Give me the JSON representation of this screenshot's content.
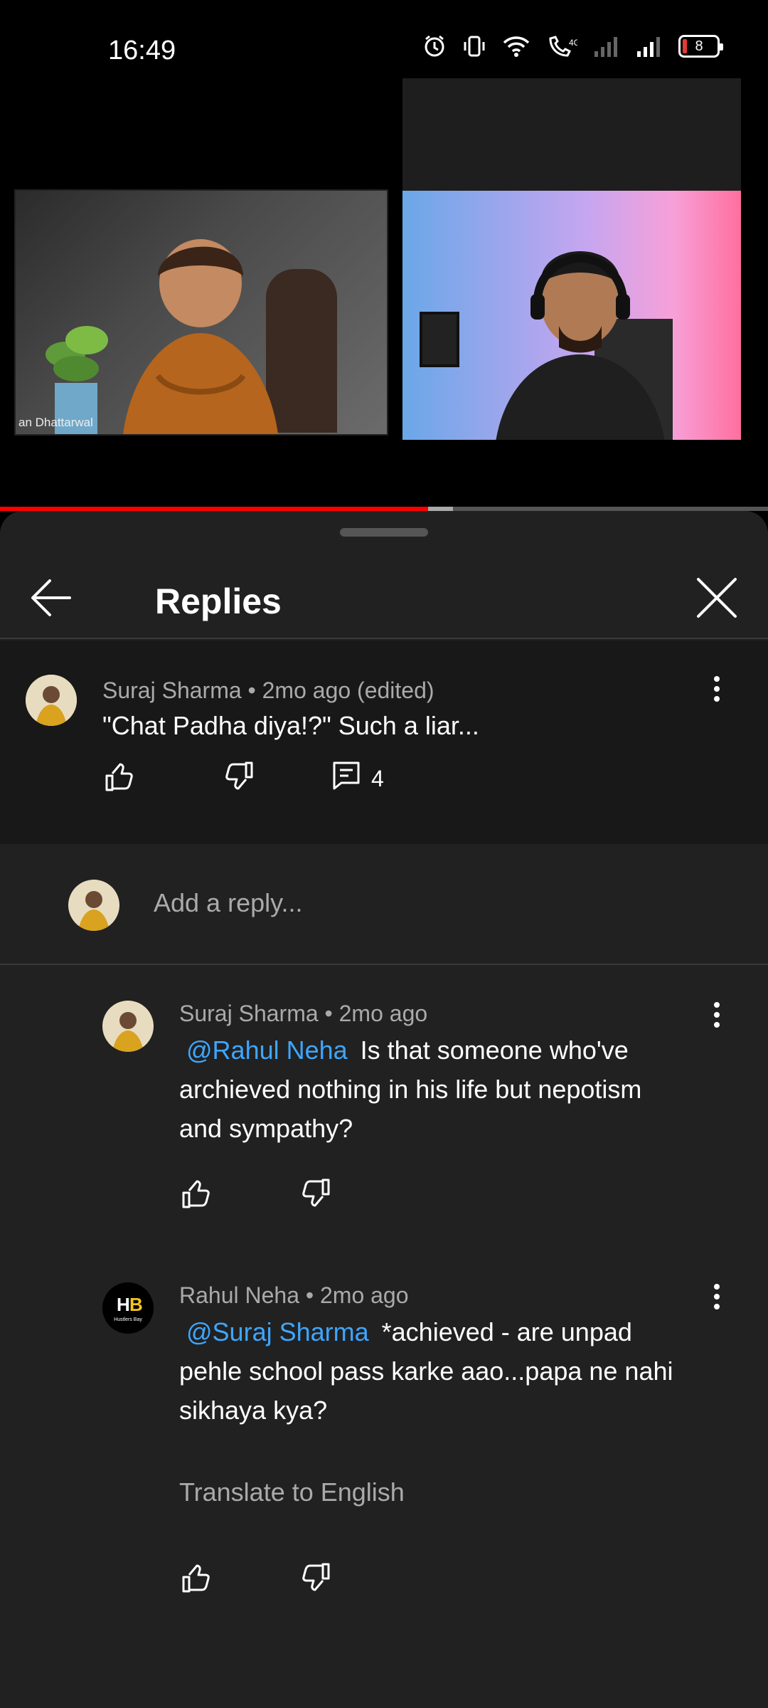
{
  "status_bar": {
    "time": "16:49",
    "battery": "8",
    "icons": [
      "alarm-icon",
      "vibrate-icon",
      "wifi-icon",
      "volte-call-icon",
      "signal-sim1-icon",
      "signal-sim2-icon",
      "battery-icon"
    ]
  },
  "video": {
    "left_participant_label": "an Dhattarwal",
    "progress": 0.557,
    "buffered": 0.59
  },
  "sheet": {
    "title": "Replies"
  },
  "parent_comment": {
    "author": "Suraj Sharma",
    "meta": "Suraj Sharma • 2mo ago (edited)",
    "text": "\"Chat Padha diya!?\" Such a liar...",
    "reply_count": "4"
  },
  "add_reply": {
    "placeholder": "Add a reply..."
  },
  "replies": [
    {
      "meta": "Suraj Sharma • 2mo ago",
      "mention": "@Rahul Neha",
      "text_line1": "Is that someone who've",
      "text_line2": "archieved nothing in his life but nepotism",
      "text_line3": "and sympathy?"
    },
    {
      "meta": "Rahul Neha • 2mo ago",
      "mention": "@Suraj Sharma",
      "text_line1": "*achieved - are unpad",
      "text_line2": "pehle school pass karke aao...papa ne nahi",
      "text_line3": "sikhaya kya?",
      "translate": "Translate to English",
      "avatar_text": "Hustlers Bay"
    }
  ]
}
